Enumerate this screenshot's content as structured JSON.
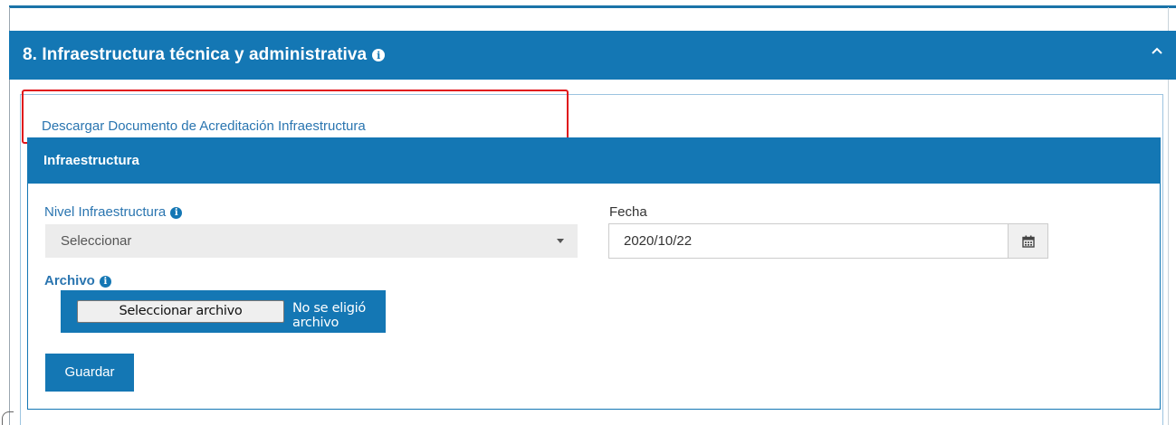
{
  "section": {
    "title": "8. Infraestructura técnica y administrativa",
    "info_icon": "info-circle-icon",
    "collapse_icon": "chevron-up-icon"
  },
  "download_link": {
    "text": "Descargar Documento de Acreditación Infraestructura"
  },
  "subsection": {
    "title": "Infraestructura"
  },
  "fields": {
    "nivel": {
      "label": "Nivel Infraestructura",
      "selected": "Seleccionar"
    },
    "fecha": {
      "label": "Fecha",
      "value": "2020/10/22",
      "icon": "calendar-icon"
    },
    "archivo": {
      "label": "Archivo",
      "button_label": "Seleccionar archivo",
      "status": "No se eligió archivo"
    }
  },
  "actions": {
    "save_label": "Guardar"
  },
  "colors": {
    "primary": "#1477b4",
    "link": "#2a75b0",
    "highlight": "#e0151b"
  }
}
